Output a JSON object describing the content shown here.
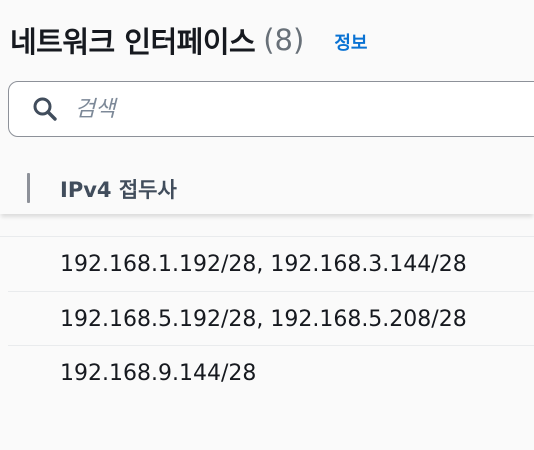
{
  "header": {
    "title": "네트워크 인터페이스",
    "count": "(8)",
    "info_link": "정보"
  },
  "search": {
    "placeholder": "검색",
    "icon": "search-icon"
  },
  "table": {
    "columns": [
      "IPv4 접두사"
    ],
    "rows": [
      {
        "ipv4_prefix": "192.168.1.192/28, 192.168.3.144/28"
      },
      {
        "ipv4_prefix": "192.168.5.192/28, 192.168.5.208/28"
      },
      {
        "ipv4_prefix": "192.168.9.144/28"
      }
    ]
  },
  "colors": {
    "link": "#0972d3",
    "text": "#16191f",
    "muted": "#687078",
    "border": "#8d9199"
  }
}
